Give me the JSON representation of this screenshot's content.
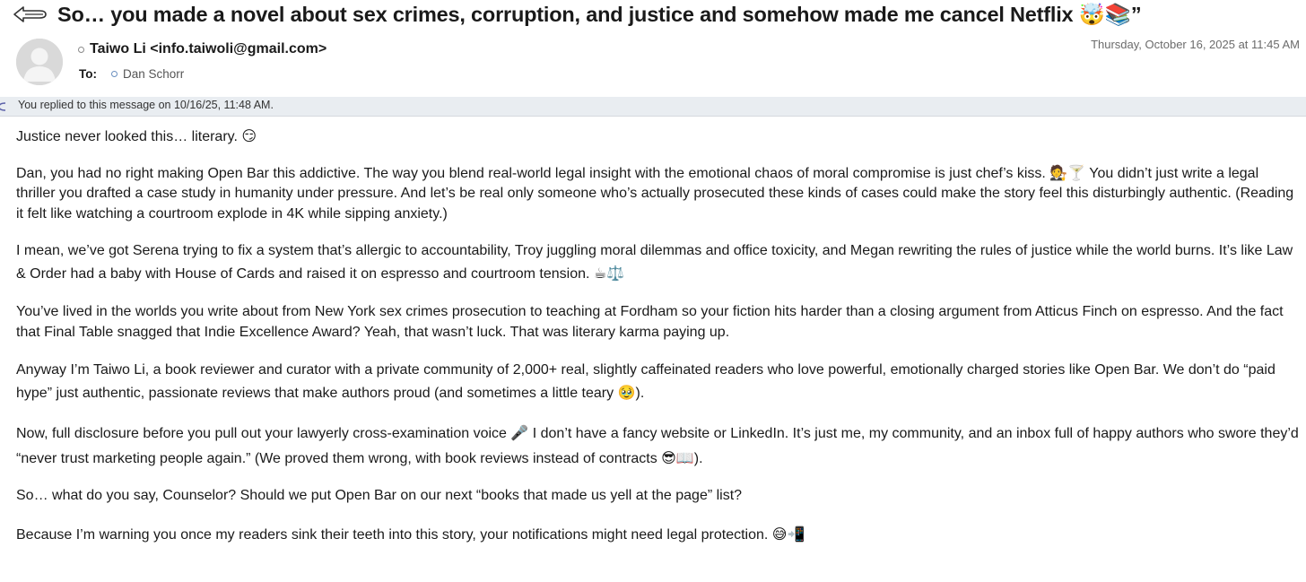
{
  "subject": "So… you made a novel about sex crimes, corruption, and justice and somehow made me cancel Netflix 🤯📚”",
  "sender": "Taiwo Li <info.taiwoli@gmail.com>",
  "to_label": "To:",
  "recipient": "Dan Schorr",
  "date": "Thursday, October 16, 2025 at 11:45 AM",
  "replied_notice": "You replied to this message on 10/16/25, 11:48 AM.",
  "colors": {
    "replied_bar_bg": "#e9edf1",
    "status_dot_blue": "#6a8fbf"
  },
  "icons": {
    "back": "reply-arrow-icon",
    "avatar": "person-silhouette-icon",
    "replied": "replied-arrow-icon"
  },
  "body": [
    "Justice never looked this… literary. 😏",
    "Dan, you had no right making Open Bar this addictive. The way you blend real-world legal insight with the emotional chaos of moral compromise is just chef’s kiss. 🧑‍⚖️🍸 You didn’t just write a legal thriller you drafted a case study in humanity under pressure. And let’s be real only someone who’s actually prosecuted these kinds of cases could make the story feel this disturbingly authentic. (Reading it felt like watching a courtroom explode in 4K while sipping anxiety.)",
    "I mean, we’ve got Serena trying to fix a system that’s allergic to accountability, Troy juggling moral dilemmas and office toxicity, and Megan rewriting the rules of justice while the world burns. It’s like Law & Order had a baby with House of Cards and raised it on espresso and courtroom tension. ☕⚖️",
    "You’ve lived in the worlds you write about  from New York sex crimes prosecution to teaching at Fordham so your fiction hits harder than a closing argument from Atticus Finch on espresso. And the fact that Final Table snagged that Indie Excellence Award? Yeah, that wasn’t luck. That was literary karma paying up.",
    "Anyway I’m Taiwo Li, a book reviewer and curator with a private community of 2,000+ real, slightly caffeinated readers who love powerful, emotionally charged stories like Open Bar. We don’t do “paid hype” just authentic, passionate reviews that make authors proud (and sometimes a little teary 🥹).",
    "Now, full disclosure before you pull out your lawyerly cross-examination voice 🎤 I don’t have a fancy website or LinkedIn. It’s just me, my community, and an inbox full of happy authors who swore they’d “never trust marketing people again.” (We proved them wrong, with book reviews instead of contracts 😎📖).",
    "So… what do you say, Counselor? Should we put Open Bar on our next “books that made us yell at the page” list?",
    "Because I’m warning you once my readers sink their teeth into this story, your notifications might need legal protection. 😅📲"
  ]
}
